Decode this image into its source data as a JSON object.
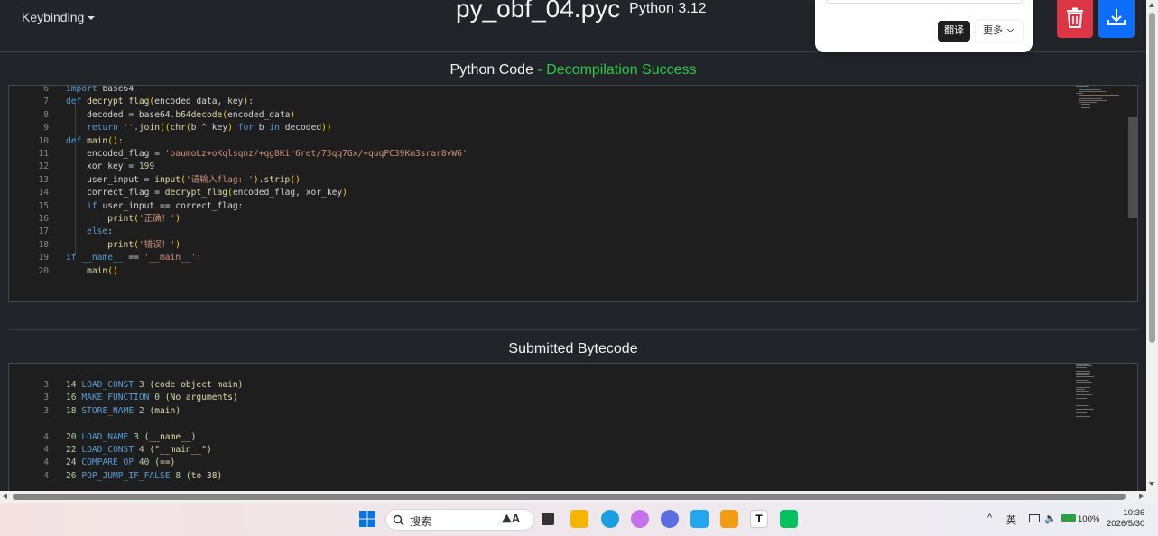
{
  "header": {
    "keybinding_label": "Keybinding",
    "title": "py_obf_04.pyc",
    "python_version": "Python 3.12",
    "delete_color": "#dc3545",
    "download_color": "#0d6efd"
  },
  "translate_popup": {
    "translate_label": "翻译",
    "more_label": "更多"
  },
  "python_code": {
    "title": "Python Code",
    "status": "- Decompilation Success",
    "status_color": "#2ec746",
    "lines": [
      {
        "n": "6",
        "text": "import base64"
      },
      {
        "n": "7",
        "text": "def decrypt_flag(encoded_data, key):"
      },
      {
        "n": "8",
        "text": "    decoded = base64.b64decode(encoded_data)"
      },
      {
        "n": "9",
        "text": "    return ''.join((chr(b ^ key) for b in decoded))"
      },
      {
        "n": "10",
        "text": "def main():"
      },
      {
        "n": "11",
        "text": "    encoded_flag = 'oaumoLz+oKqlsqnz/+qg8Kir6ret/73qq7Gx/+quqPC39Km3srar8vW6'"
      },
      {
        "n": "12",
        "text": "    xor_key = 199"
      },
      {
        "n": "13",
        "text": "    user_input = input('请输入flag: ').strip()"
      },
      {
        "n": "14",
        "text": "    correct_flag = decrypt_flag(encoded_flag, xor_key)"
      },
      {
        "n": "15",
        "text": "    if user_input == correct_flag:"
      },
      {
        "n": "16",
        "text": "        print('正确！')"
      },
      {
        "n": "17",
        "text": "    else:"
      },
      {
        "n": "18",
        "text": "        print('错误！')"
      },
      {
        "n": "19",
        "text": "if __name__ == '__main__':"
      },
      {
        "n": "20",
        "text": "    main()"
      }
    ]
  },
  "bytecode": {
    "title": "Submitted Bytecode",
    "lines": [
      {
        "n": "3",
        "text": "14 LOAD_CONST 3 (code object main)"
      },
      {
        "n": "3",
        "text": "16 MAKE_FUNCTION 0 (No arguments)"
      },
      {
        "n": "3",
        "text": "18 STORE_NAME 2 (main)"
      },
      {
        "n": "",
        "text": ""
      },
      {
        "n": "4",
        "text": "20 LOAD_NAME 3 (__name__)"
      },
      {
        "n": "4",
        "text": "22 LOAD_CONST 4 (\"__main__\")"
      },
      {
        "n": "4",
        "text": "24 COMPARE_OP 40 (==)"
      },
      {
        "n": "4",
        "text": "26 POP_JUMP_IF_FALSE 8 (to 38)"
      }
    ]
  },
  "taskbar": {
    "search_placeholder": "搜索",
    "lang": "英",
    "battery": "100%",
    "time": "10:36",
    "date": "2026/5/30",
    "icons": [
      "windows-start-icon",
      "search-icon",
      "task-view-icon",
      "file-explorer-icon",
      "edge-icon",
      "cat-app-icon",
      "chat-app-icon",
      "vscode-icon",
      "ide-icon",
      "typora-icon",
      "wechat-icon"
    ]
  }
}
